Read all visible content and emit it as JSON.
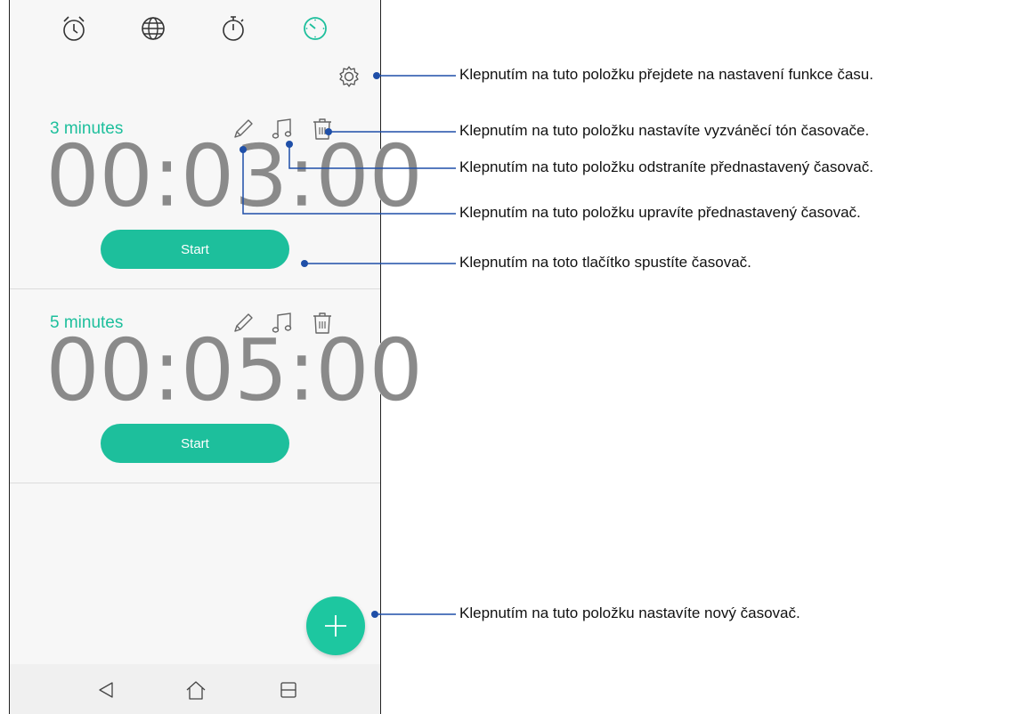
{
  "tabs": [
    {
      "icon": "alarm-clock-icon"
    },
    {
      "icon": "world-clock-icon"
    },
    {
      "icon": "stopwatch-icon"
    },
    {
      "icon": "timer-icon",
      "active": true
    }
  ],
  "colors": {
    "accent": "#1dbf9c",
    "digits": "#8a8a8a",
    "callout_line": "#1f4fa8"
  },
  "timers": [
    {
      "label": "3 minutes",
      "time": "00:03:00",
      "start_label": "Start"
    },
    {
      "label": "5 minutes",
      "time": "00:05:00",
      "start_label": "Start"
    }
  ],
  "callouts": {
    "settings": "Klepnutím na tuto položku přejdete na nastavení funkce času.",
    "ringtone": "Klepnutím na tuto položku nastavíte vyzváněcí tón časovače.",
    "delete": "Klepnutím na tuto položku odstraníte přednastavený časovač.",
    "edit": "Klepnutím na tuto položku upravíte přednastavený časovač.",
    "start": "Klepnutím na toto tlačítko spustíte časovač.",
    "add": "Klepnutím na tuto položku nastavíte nový časovač."
  }
}
